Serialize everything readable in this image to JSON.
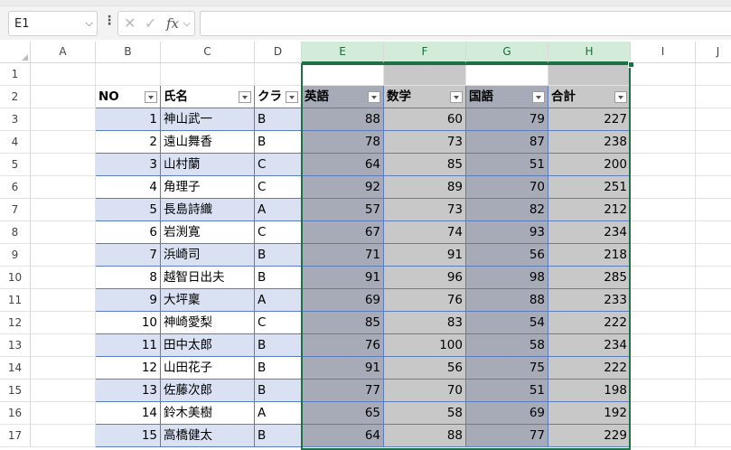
{
  "name_box": "E1",
  "formula_value": "",
  "columns": [
    "A",
    "B",
    "C",
    "D",
    "E",
    "F",
    "G",
    "H",
    "I",
    "J"
  ],
  "selected_columns": [
    "E",
    "F",
    "G",
    "H"
  ],
  "rows": [
    "1",
    "2",
    "3",
    "4",
    "5",
    "6",
    "7",
    "8",
    "9",
    "10",
    "11",
    "12",
    "13",
    "14",
    "15",
    "16",
    "17"
  ],
  "table": {
    "headers": [
      "NO",
      "氏名",
      "クラ",
      "英語",
      "数学",
      "国語",
      "合計"
    ],
    "rows": [
      [
        "1",
        "神山武一",
        "B",
        "88",
        "60",
        "79",
        "227"
      ],
      [
        "2",
        "遠山舞香",
        "B",
        "78",
        "73",
        "87",
        "238"
      ],
      [
        "3",
        "山村蘭",
        "C",
        "64",
        "85",
        "51",
        "200"
      ],
      [
        "4",
        "角理子",
        "C",
        "92",
        "89",
        "70",
        "251"
      ],
      [
        "5",
        "長島詩織",
        "A",
        "57",
        "73",
        "82",
        "212"
      ],
      [
        "6",
        "岩渕寛",
        "C",
        "67",
        "74",
        "93",
        "234"
      ],
      [
        "7",
        "浜崎司",
        "B",
        "71",
        "91",
        "56",
        "218"
      ],
      [
        "8",
        "越智日出夫",
        "B",
        "91",
        "96",
        "98",
        "285"
      ],
      [
        "9",
        "大坪稟",
        "A",
        "69",
        "76",
        "88",
        "233"
      ],
      [
        "10",
        "神崎愛梨",
        "C",
        "85",
        "83",
        "54",
        "222"
      ],
      [
        "11",
        "田中太郎",
        "B",
        "76",
        "100",
        "58",
        "234"
      ],
      [
        "12",
        "山田花子",
        "B",
        "91",
        "56",
        "75",
        "222"
      ],
      [
        "13",
        "佐藤次郎",
        "B",
        "77",
        "70",
        "51",
        "198"
      ],
      [
        "14",
        "鈴木美樹",
        "A",
        "65",
        "58",
        "69",
        "192"
      ],
      [
        "15",
        "高橋健太",
        "B",
        "64",
        "88",
        "77",
        "229"
      ]
    ]
  }
}
